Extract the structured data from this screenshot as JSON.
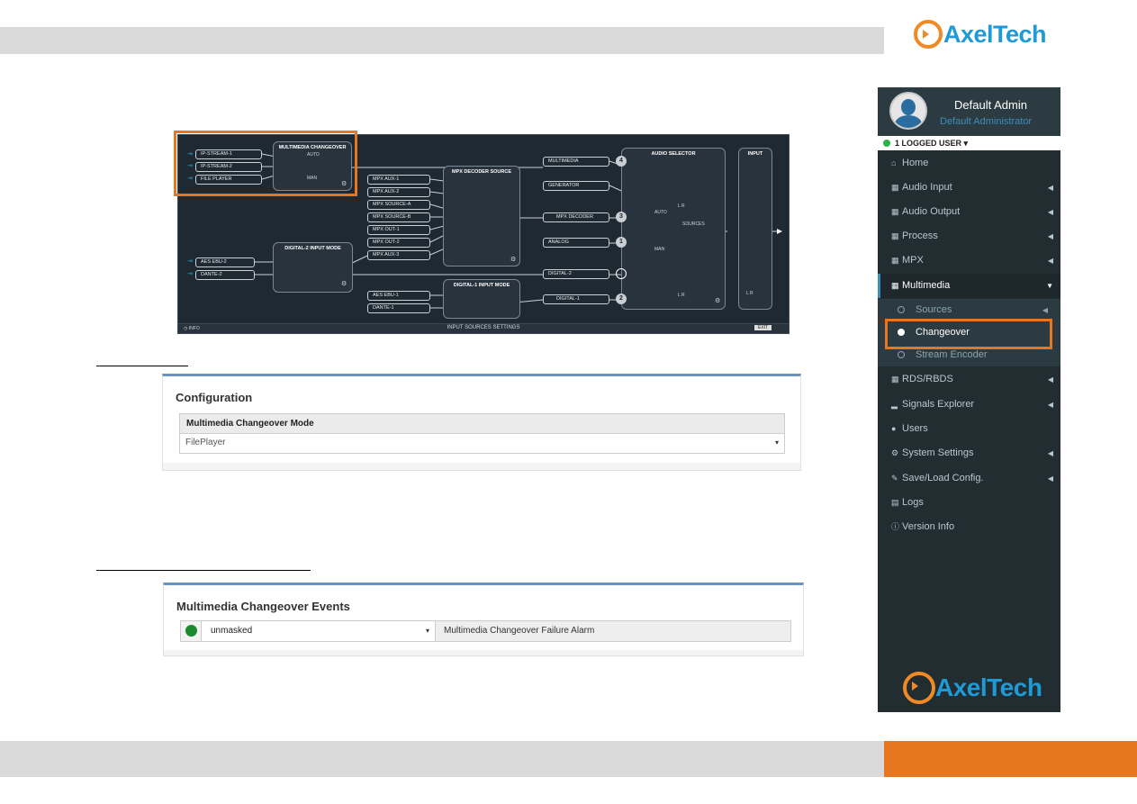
{
  "brand": {
    "name": "AxelTech",
    "accent": "#e8761e",
    "blue": "#1e9ad6"
  },
  "diagram": {
    "inputs_top": [
      "IP-STREAM-1",
      "IP-STREAM-2",
      "FILE PLAYER"
    ],
    "multimedia_changeover": {
      "title": "MULTIMEDIA CHANGEOVER",
      "auto": "AUTO",
      "man": "MAN"
    },
    "digital2_mode": {
      "title": "DIGITAL-2 INPUT MODE"
    },
    "inputs_mid": [
      "AES EBU-2",
      "DANTE-2"
    ],
    "mpx_inputs": [
      "MPX AUX-1",
      "MPX AUX-2",
      "MPX SOURCE-A",
      "MPX SOURCE-B",
      "MPX OUT-1",
      "MPX OUT-2",
      "MPX AUX-3"
    ],
    "mpx_decoder": {
      "title": "MPX DECODER SOURCE"
    },
    "digital1_mode": {
      "title": "DIGITAL-1 INPUT MODE"
    },
    "inputs_bottom": [
      "AES EBU-1",
      "DANTE-1"
    ],
    "sources": [
      "MULTIMEDIA",
      "GENERATOR",
      "MPX DECODER",
      "ANALOG",
      "DIGITAL-2",
      "DIGITAL-1"
    ],
    "source_numbers": [
      "4",
      "3",
      "1",
      "2"
    ],
    "audio_selector": {
      "title": "AUDIO SELECTOR",
      "auto": "AUTO",
      "man": "MAN",
      "sources": "SOURCES",
      "lr": "L R"
    },
    "input_meter": {
      "title": "INPUT",
      "lr": "L R"
    },
    "footer": {
      "info": "INFO",
      "title": "INPUT SOURCES SETTINGS",
      "exit": "EXIT"
    }
  },
  "configuration": {
    "title": "Configuration",
    "field_label": "Multimedia Changeover Mode",
    "value": "FilePlayer"
  },
  "events": {
    "title": "Multimedia Changeover Events",
    "status_color": "#1b8a2e",
    "mask_value": "unmasked",
    "event_name": "Multimedia Changeover Failure Alarm"
  },
  "sidebar": {
    "user_name": "Default Admin",
    "user_role": "Default Administrator",
    "logged_users": "1 LOGGED USER",
    "items": [
      {
        "label": "Home",
        "icon": "home-icon"
      },
      {
        "label": "Audio Input",
        "icon": "grid-icon"
      },
      {
        "label": "Audio Output",
        "icon": "grid-icon"
      },
      {
        "label": "Process",
        "icon": "grid-icon"
      },
      {
        "label": "MPX",
        "icon": "grid-icon"
      },
      {
        "label": "Multimedia",
        "icon": "grid-icon"
      },
      {
        "label": "RDS/RBDS",
        "icon": "grid-icon"
      },
      {
        "label": "Signals Explorer",
        "icon": "signal-icon"
      },
      {
        "label": "Users",
        "icon": "user-icon"
      },
      {
        "label": "System Settings",
        "icon": "gears-icon"
      },
      {
        "label": "Save/Load Config.",
        "icon": "wrench-icon"
      },
      {
        "label": "Logs",
        "icon": "logs-icon"
      },
      {
        "label": "Version Info",
        "icon": "info-icon"
      }
    ],
    "sub_items": [
      "Sources",
      "Changeover",
      "Stream Encoder"
    ]
  }
}
